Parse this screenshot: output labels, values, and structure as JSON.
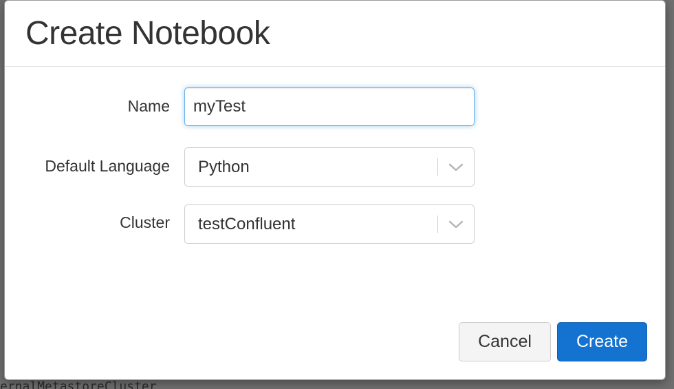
{
  "background": {
    "partial_text": "ernalMetastoreCluster"
  },
  "dialog": {
    "title": "Create Notebook",
    "fields": {
      "name": {
        "label": "Name",
        "value": "myTest"
      },
      "language": {
        "label": "Default Language",
        "value": "Python"
      },
      "cluster": {
        "label": "Cluster",
        "value": "testConfluent"
      }
    },
    "buttons": {
      "cancel_label": "Cancel",
      "create_label": "Create"
    }
  },
  "icons": {
    "dropdown": "chevron-down-icon"
  },
  "colors": {
    "primary_button": "#1472d0",
    "focus_border": "#66afe9",
    "text": "#333333"
  }
}
